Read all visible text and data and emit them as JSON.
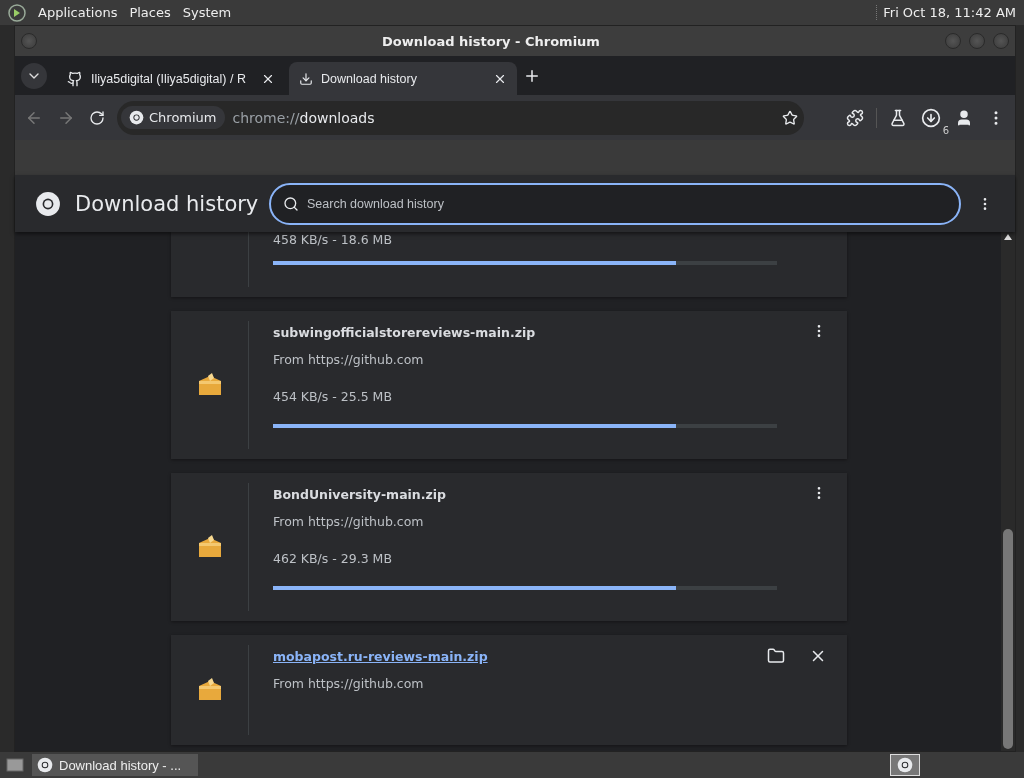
{
  "top_panel": {
    "menus": [
      "Applications",
      "Places",
      "System"
    ],
    "clock": "Fri Oct 18, 11:42 AM"
  },
  "window": {
    "title": "Download history - Chromium"
  },
  "tabs": [
    {
      "label": "Iliya5digital (Iliya5digital) / R",
      "selected": false
    },
    {
      "label": "Download history",
      "selected": true
    }
  ],
  "address_bar": {
    "site_chip": "Chromium",
    "url_scheme": "chrome://",
    "url_path": "downloads"
  },
  "download_badge": "6",
  "page": {
    "title": "Download history",
    "search": {
      "placeholder": "Search download history"
    }
  },
  "downloads": [
    {
      "kind": "partial",
      "status": "458 KB/s - 18.6 MB",
      "level": 0.8
    },
    {
      "kind": "progress",
      "name": "subwingofficialstorereviews-main.zip",
      "source": "From https://github.com",
      "status": "454 KB/s - 25.5 MB",
      "level": 0.8
    },
    {
      "kind": "progress",
      "name": "BondUniversity-main.zip",
      "source": "From https://github.com",
      "status": "462 KB/s - 29.3 MB",
      "level": 0.8
    },
    {
      "kind": "complete",
      "name": "mobapost.ru-reviews-main.zip",
      "source": "From https://github.com"
    }
  ],
  "taskbar": {
    "items": [
      {
        "label": "Download history - ...",
        "selected": true
      }
    ]
  }
}
